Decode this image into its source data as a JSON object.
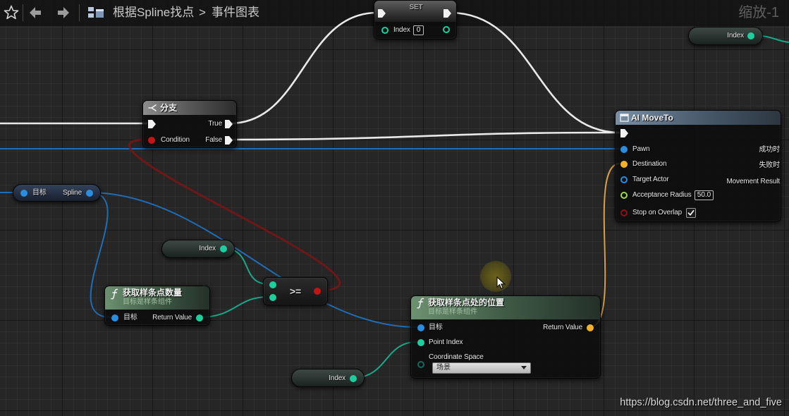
{
  "toolbar": {
    "blueprint_name": "根据Spline找点",
    "separator": ">",
    "graph_name": "事件图表",
    "zoom": "缩放-1"
  },
  "set_node": {
    "title": "SET",
    "variable": "Index",
    "value": "0"
  },
  "index_getter_top": {
    "label": "Index"
  },
  "branch_node": {
    "title": "分支",
    "true_label": "True",
    "condition_label": "Condition",
    "false_label": "False"
  },
  "ai_moveto_node": {
    "title": "AI MoveTo",
    "pawn": "Pawn",
    "destination": "Destination",
    "target_actor": "Target Actor",
    "acceptance_radius": "Acceptance Radius",
    "acceptance_radius_value": "50.0",
    "stop_on_overlap": "Stop on Overlap",
    "stop_on_overlap_checked": true,
    "on_success": "成功时",
    "on_fail": "失败时",
    "movement_result": "Movement Result"
  },
  "spline_getter": {
    "target": "目标",
    "output": "Spline"
  },
  "index_getter_mid": {
    "label": "Index"
  },
  "compare_node": {
    "operator": ">="
  },
  "num_points_node": {
    "title": "获取样条点数量",
    "subtitle": "目标是样条组件",
    "target": "目标",
    "return_value": "Return Value"
  },
  "location_node": {
    "title": "获取样条点处的位置",
    "subtitle": "目标是样条组件",
    "target": "目标",
    "return_value": "Return Value",
    "point_index": "Point Index",
    "coordinate_space": "Coordinate Space",
    "coordinate_space_value": "场景"
  },
  "index_getter_bottom": {
    "label": "Index"
  },
  "watermark": "https://blog.csdn.net/three_and_five",
  "pin_colors": {
    "exec": "#f2f2f2",
    "object": "#2a8ee0",
    "integer": "#1ecf9e",
    "vector": "#f6b12a",
    "float": "#9fd64f",
    "boolean": "#c21616",
    "boolean_dim": "#8a1212",
    "enum": "#0f6b5c"
  },
  "icons": {
    "toolbar": [
      "star-icon",
      "back-arrow-icon",
      "forward-arrow-icon",
      "graph-icon"
    ],
    "branch": "branch-icon",
    "ai_moveto": "node-icon",
    "functions": "function-icon",
    "dropdown": "dropdown-arrow-icon",
    "checkbox": "checkmark-icon",
    "cursor": "mouse-cursor-icon"
  }
}
